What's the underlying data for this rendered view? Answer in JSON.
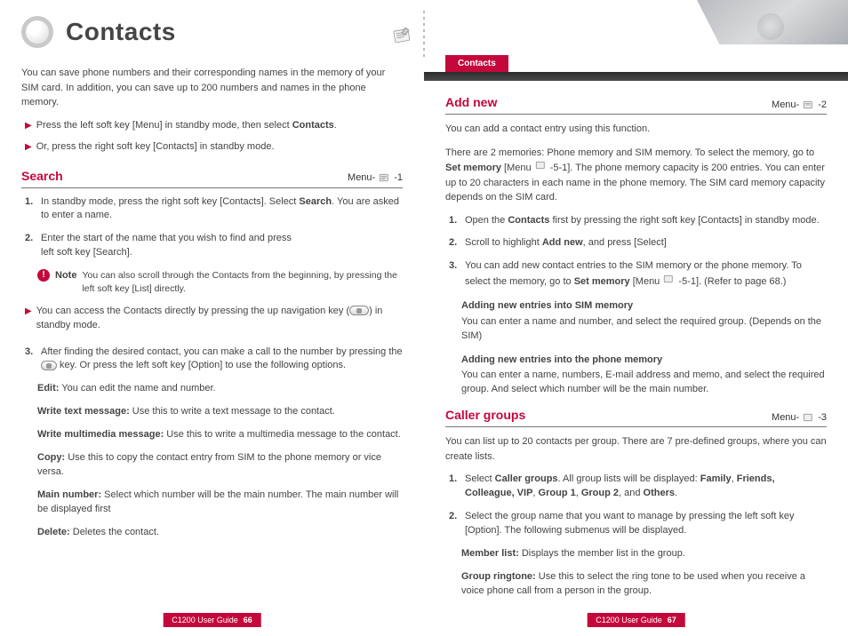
{
  "title": "Contacts",
  "tab_label": "Contacts",
  "left": {
    "intro": "You can save phone numbers and their corresponding names in the memory of your SIM card. In addition, you can save up to 200 numbers and names in the phone memory.",
    "bullets": [
      {
        "pre": "Press the left soft key [Menu] in standby mode, then select ",
        "bold": "Contacts",
        "post": "."
      },
      {
        "pre": "Or, press the right soft key [Contacts] in standby mode.",
        "bold": "",
        "post": ""
      }
    ],
    "search": {
      "heading": "Search",
      "menu_prefix": "Menu-",
      "menu_suffix": " -1",
      "items": {
        "i1_a": "In standby mode, press the right soft key [Contacts]. Select ",
        "i1_b": "Search",
        "i1_c": ". You are asked to enter a name.",
        "i2_a": "Enter the start of the name that you wish to find and press",
        "i2_b": "left soft key [Search].",
        "note_label": "Note",
        "note_text": "You can also scroll through the Contacts from the beginning, by pressing the left soft key [List] directly.",
        "nav_a": "You can access the Contacts directly by pressing the up navigation key (",
        "nav_b": ") in standby mode.",
        "i3_a": "After finding the desired contact, you can make a call to the number by pressing the ",
        "i3_b": " key. Or press the left soft key [Option] to use the following options."
      },
      "options": {
        "edit_l": "Edit:",
        "edit_t": " You can edit the name and number.",
        "wtm_l": "Write text message:",
        "wtm_t": " Use this to write a text message to the contact.",
        "wmm_l": "Write multimedia message:",
        "wmm_t": " Use this to write a multimedia message to the contact.",
        "cpy_l": "Copy:",
        "cpy_t": " Use this to copy the contact entry from SIM to the phone memory or vice versa.",
        "mn_l": "Main number:",
        "mn_t": " Select which number will be the main number. The main number will be displayed first",
        "del_l": "Delete:",
        "del_t": " Deletes the contact."
      }
    },
    "footer_label": "C1200 User Guide",
    "footer_page": "66"
  },
  "right": {
    "addnew": {
      "heading": "Add new",
      "menu_prefix": "Menu-",
      "menu_suffix": " -2",
      "p1": "You can add a contact entry using this function.",
      "p2_a": "There are 2 memories: Phone memory and SIM memory. To select the memory, go to ",
      "p2_b": "Set memory",
      "p2_c": " [Menu ",
      "p2_d": " -5-1]. The phone memory capacity is 200 entries. You can enter up to 20 characters in each name in the phone memory. The SIM card memory capacity depends on the SIM card.",
      "i1_a": "Open the ",
      "i1_b": "Contacts",
      "i1_c": " first by pressing the right soft key [Contacts] in standby mode.",
      "i2_a": "Scroll to highlight ",
      "i2_b": "Add new",
      "i2_c": ", and press [Select]",
      "i3_a": "You can add new contact entries to the SIM memory or the phone memory. To select the memory, go to ",
      "i3_b": "Set memory",
      "i3_c": " [Menu ",
      "i3_d": " -5-1]. (Refer to page 68.)",
      "sim_h": "Adding new entries into SIM memory",
      "sim_t": "You can enter a name and number, and select the required group. (Depends on the SIM)",
      "ph_h": "Adding new entries into the phone memory",
      "ph_t": "You can enter a name, numbers, E-mail address and memo, and select the required group. And select which number will be the main number."
    },
    "caller": {
      "heading": "Caller groups",
      "menu_prefix": "Menu-",
      "menu_suffix": " -3",
      "p1": "You can list up to 20 contacts per group. There are 7 pre-defined groups, where you can create lists.",
      "i1_a": "Select ",
      "i1_b": "Caller groups",
      "i1_c": ". All group lists will be displayed: ",
      "i1_d": "Family",
      "i1_e": ", ",
      "i1_f": "Friends, Colleague, VIP",
      "i1_g": ", ",
      "i1_h": "Group 1",
      "i1_i": ", ",
      "i1_j": "Group 2",
      "i1_k": ", and ",
      "i1_l": "Others",
      "i1_m": ".",
      "i2": "Select the group name that you want to manage by pressing the left soft key [Option]. The following submenus will be displayed.",
      "ml_l": "Member list:",
      "ml_t": " Displays the member list in the group.",
      "gr_l": "Group ringtone:",
      "gr_t": " Use this to select the ring tone to be used when you receive a voice phone call from a person in the group."
    },
    "footer_label": "C1200 User Guide",
    "footer_page": "67"
  }
}
